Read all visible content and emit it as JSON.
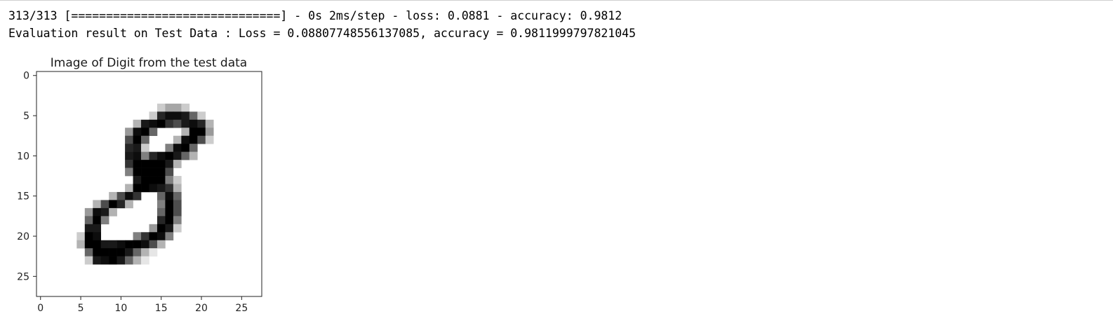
{
  "output": {
    "progress_line": "313/313 [==============================] - 0s 2ms/step - loss: 0.0881 - accuracy: 0.9812",
    "result_line": "Evaluation result on Test Data : Loss = 0.08807748556137085, accuracy = 0.9811999797821045"
  },
  "chart_data": {
    "type": "heatmap",
    "title": "Image of Digit from the test data",
    "colormap": "binary",
    "xlim": [
      -0.5,
      27.5
    ],
    "ylim": [
      27.5,
      -0.5
    ],
    "x_ticks": [
      0,
      5,
      10,
      15,
      20,
      25
    ],
    "y_ticks": [
      0,
      5,
      10,
      15,
      20,
      25
    ],
    "grid": false,
    "pixels": [
      {
        "row": 4,
        "cols": [
          [
            15,
            0.2
          ],
          [
            16,
            0.35
          ],
          [
            17,
            0.35
          ],
          [
            18,
            0.2
          ]
        ]
      },
      {
        "row": 5,
        "cols": [
          [
            14,
            0.2
          ],
          [
            15,
            0.85
          ],
          [
            16,
            0.95
          ],
          [
            17,
            0.95
          ],
          [
            18,
            0.9
          ],
          [
            19,
            0.6
          ],
          [
            20,
            0.2
          ]
        ]
      },
      {
        "row": 6,
        "cols": [
          [
            12,
            0.3
          ],
          [
            13,
            0.9
          ],
          [
            14,
            0.95
          ],
          [
            15,
            1
          ],
          [
            16,
            0.8
          ],
          [
            17,
            0.7
          ],
          [
            18,
            0.9
          ],
          [
            19,
            0.95
          ],
          [
            20,
            0.85
          ],
          [
            21,
            0.3
          ]
        ]
      },
      {
        "row": 7,
        "cols": [
          [
            11,
            0.4
          ],
          [
            12,
            0.95
          ],
          [
            13,
            1
          ],
          [
            14,
            0.6
          ],
          [
            18,
            0.3
          ],
          [
            19,
            1
          ],
          [
            20,
            1
          ],
          [
            21,
            0.4
          ]
        ]
      },
      {
        "row": 8,
        "cols": [
          [
            11,
            0.7
          ],
          [
            12,
            1
          ],
          [
            13,
            0.6
          ],
          [
            17,
            0.3
          ],
          [
            18,
            0.95
          ],
          [
            19,
            1
          ],
          [
            20,
            0.7
          ],
          [
            21,
            0.2
          ]
        ]
      },
      {
        "row": 9,
        "cols": [
          [
            11,
            0.85
          ],
          [
            12,
            0.9
          ],
          [
            13,
            0.2
          ],
          [
            16,
            0.5
          ],
          [
            17,
            0.95
          ],
          [
            18,
            1
          ],
          [
            19,
            0.6
          ]
        ]
      },
      {
        "row": 10,
        "cols": [
          [
            11,
            0.9
          ],
          [
            12,
            0.95
          ],
          [
            13,
            0.5
          ],
          [
            14,
            0.85
          ],
          [
            15,
            0.95
          ],
          [
            16,
            1
          ],
          [
            17,
            0.9
          ],
          [
            18,
            0.6
          ],
          [
            19,
            0.3
          ]
        ]
      },
      {
        "row": 11,
        "cols": [
          [
            11,
            0.8
          ],
          [
            12,
            1
          ],
          [
            13,
            1
          ],
          [
            14,
            1
          ],
          [
            15,
            1
          ],
          [
            16,
            0.9
          ],
          [
            17,
            0.3
          ]
        ]
      },
      {
        "row": 12,
        "cols": [
          [
            11,
            0.5
          ],
          [
            12,
            1
          ],
          [
            13,
            1
          ],
          [
            14,
            1
          ],
          [
            15,
            1
          ],
          [
            16,
            0.7
          ]
        ]
      },
      {
        "row": 13,
        "cols": [
          [
            12,
            0.9
          ],
          [
            13,
            1
          ],
          [
            14,
            1
          ],
          [
            15,
            1
          ],
          [
            16,
            0.5
          ],
          [
            17,
            0.2
          ]
        ]
      },
      {
        "row": 14,
        "cols": [
          [
            11,
            0.3
          ],
          [
            12,
            1
          ],
          [
            13,
            1
          ],
          [
            14,
            0.95
          ],
          [
            15,
            0.9
          ],
          [
            16,
            0.8
          ],
          [
            17,
            0.3
          ]
        ]
      },
      {
        "row": 15,
        "cols": [
          [
            9,
            0.3
          ],
          [
            10,
            0.7
          ],
          [
            11,
            0.95
          ],
          [
            12,
            0.8
          ],
          [
            15,
            0.6
          ],
          [
            16,
            0.95
          ],
          [
            17,
            0.6
          ]
        ]
      },
      {
        "row": 16,
        "cols": [
          [
            7,
            0.3
          ],
          [
            8,
            0.7
          ],
          [
            9,
            1
          ],
          [
            10,
            0.85
          ],
          [
            11,
            0.3
          ],
          [
            15,
            0.5
          ],
          [
            16,
            1
          ],
          [
            17,
            0.7
          ]
        ]
      },
      {
        "row": 17,
        "cols": [
          [
            6,
            0.4
          ],
          [
            7,
            0.95
          ],
          [
            8,
            0.9
          ],
          [
            9,
            0.3
          ],
          [
            15,
            0.6
          ],
          [
            16,
            1
          ],
          [
            17,
            0.7
          ]
        ]
      },
      {
        "row": 18,
        "cols": [
          [
            6,
            0.6
          ],
          [
            7,
            1
          ],
          [
            8,
            0.5
          ],
          [
            15,
            0.85
          ],
          [
            16,
            1
          ],
          [
            17,
            0.5
          ]
        ]
      },
      {
        "row": 19,
        "cols": [
          [
            6,
            0.9
          ],
          [
            7,
            0.9
          ],
          [
            14,
            0.4
          ],
          [
            15,
            1
          ],
          [
            16,
            0.9
          ],
          [
            17,
            0.2
          ]
        ]
      },
      {
        "row": 20,
        "cols": [
          [
            5,
            0.2
          ],
          [
            6,
            1
          ],
          [
            7,
            0.95
          ],
          [
            12,
            0.5
          ],
          [
            13,
            0.8
          ],
          [
            14,
            1
          ],
          [
            15,
            0.95
          ],
          [
            16,
            0.5
          ]
        ]
      },
      {
        "row": 21,
        "cols": [
          [
            5,
            0.3
          ],
          [
            6,
            1
          ],
          [
            7,
            1
          ],
          [
            8,
            0.9
          ],
          [
            9,
            0.9
          ],
          [
            10,
            0.95
          ],
          [
            11,
            1
          ],
          [
            12,
            1
          ],
          [
            13,
            0.95
          ],
          [
            14,
            0.7
          ],
          [
            15,
            0.3
          ]
        ]
      },
      {
        "row": 22,
        "cols": [
          [
            6,
            0.6
          ],
          [
            7,
            1
          ],
          [
            8,
            1
          ],
          [
            9,
            1
          ],
          [
            10,
            1
          ],
          [
            11,
            0.9
          ],
          [
            12,
            0.6
          ],
          [
            13,
            0.3
          ],
          [
            14,
            0.1
          ]
        ]
      },
      {
        "row": 23,
        "cols": [
          [
            6,
            0.2
          ],
          [
            7,
            0.9
          ],
          [
            8,
            0.95
          ],
          [
            9,
            1
          ],
          [
            10,
            0.9
          ],
          [
            11,
            0.6
          ],
          [
            12,
            0.3
          ],
          [
            13,
            0.1
          ]
        ]
      }
    ]
  }
}
